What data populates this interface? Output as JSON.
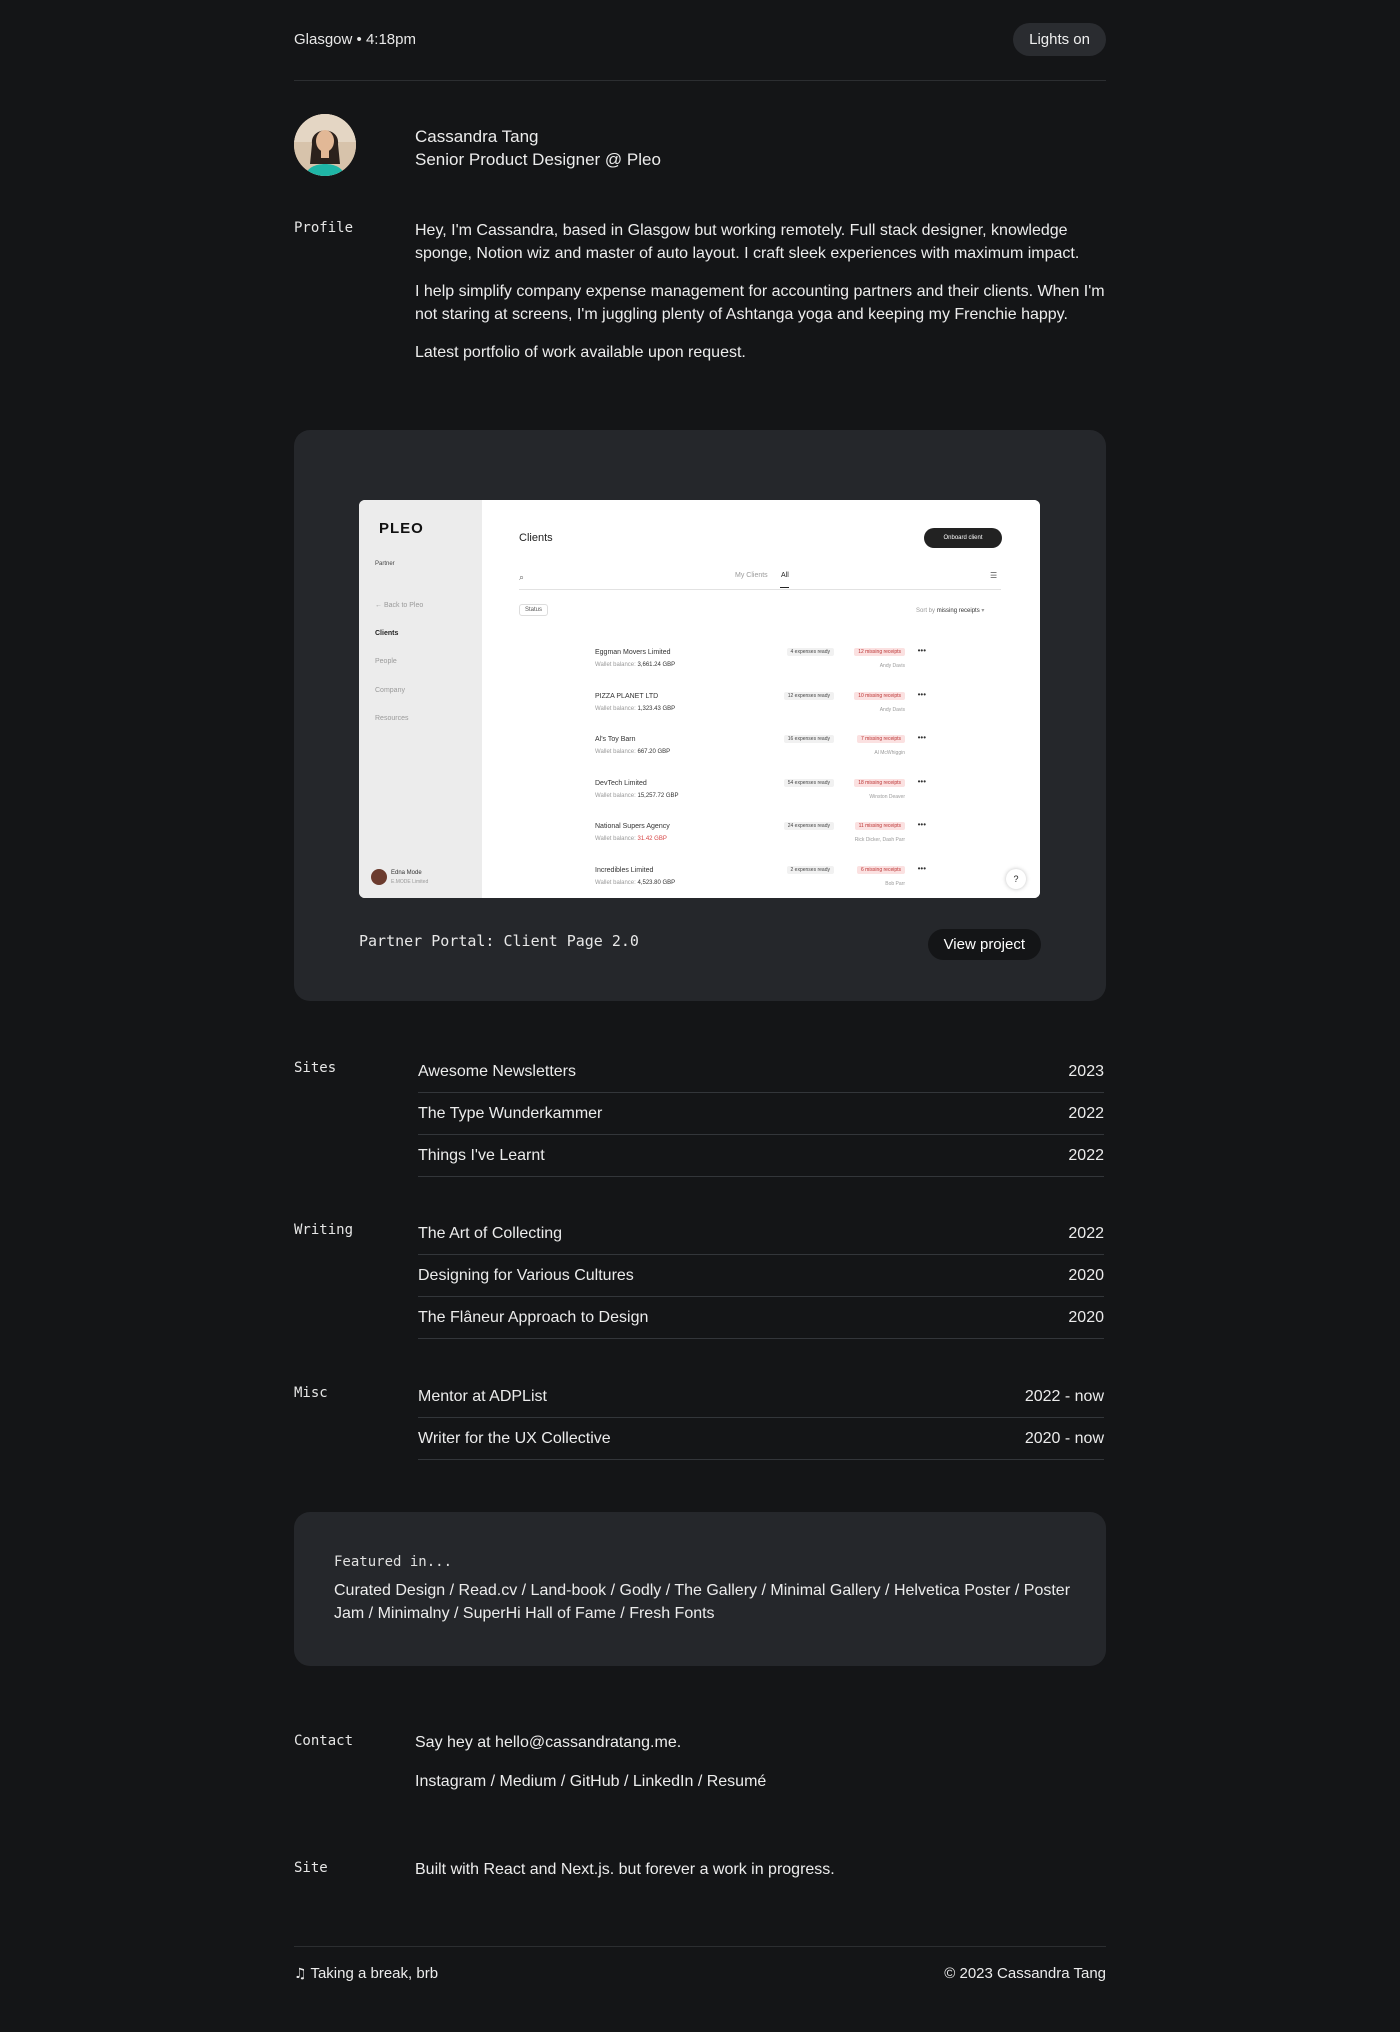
{
  "header": {
    "location_time": "Glasgow • 4:18pm",
    "lights_label": "Lights on"
  },
  "identity": {
    "name": "Cassandra Tang",
    "role": "Senior Product Designer @ Pleo"
  },
  "profile": {
    "label": "Profile",
    "paragraphs": [
      "Hey, I'm Cassandra, based in Glasgow but working remotely. Full stack designer, knowledge sponge, Notion wiz and master of auto layout. I craft sleek experiences with maximum impact.",
      "I help simplify company expense management for accounting partners and their clients. When I'm not staring at screens, I'm juggling plenty of Ashtanga yoga and keeping my Frenchie happy.",
      "Latest portfolio of work available upon request."
    ]
  },
  "project": {
    "caption": "Partner Portal: Client Page 2.0",
    "view_label": "View project",
    "screenshot": {
      "logo": "PLEO",
      "logo_sub": "Partner",
      "back": "← Back to Pleo",
      "nav": [
        "Clients",
        "People",
        "Company",
        "Resources"
      ],
      "user_name": "Edna Mode",
      "user_company": "E.MODE Limited",
      "page_title": "Clients",
      "onboard_label": "Onboard client",
      "tabs": [
        "My Clients",
        "All"
      ],
      "status_filter": "Status",
      "sort_prefix": "Sort by",
      "sort_value": "missing receipts",
      "help": "?",
      "clients": [
        {
          "name": "Eggman Movers Limited",
          "balance_label": "Wallet balance:",
          "balance": "3,661.24 GBP",
          "ready": "4 expenses ready",
          "missing": "12 missing receipts",
          "owner": "Andy Davis"
        },
        {
          "name": "PIZZA PLANET LTD",
          "balance_label": "Wallet balance:",
          "balance": "1,323.43 GBP",
          "ready": "12 expenses ready",
          "missing": "10 missing receipts",
          "owner": "Andy Davis"
        },
        {
          "name": "Al's Toy Barn",
          "balance_label": "Wallet balance:",
          "balance": "667.20 GBP",
          "ready": "16 expenses ready",
          "missing": "7 missing receipts",
          "owner": "Al McWhiggin"
        },
        {
          "name": "DevTech Limited",
          "balance_label": "Wallet balance:",
          "balance": "15,257.72 GBP",
          "ready": "54 expenses ready",
          "missing": "18 missing receipts",
          "owner": "Winston Deaver"
        },
        {
          "name": "National Supers Agency",
          "balance_label": "Wallet balance:",
          "balance": "31.42 GBP",
          "ready": "24 expenses ready",
          "missing": "11 missing receipts",
          "owner": "Rick Dicker, Dash Parr"
        },
        {
          "name": "Incredibles Limited",
          "balance_label": "Wallet balance:",
          "balance": "4,523.80 GBP",
          "ready": "2 expenses ready",
          "missing": "6 missing receipts",
          "owner": "Bob Parr"
        }
      ]
    }
  },
  "sites": {
    "label": "Sites",
    "items": [
      {
        "title": "Awesome Newsletters",
        "year": "2023"
      },
      {
        "title": "The Type Wunderkammer",
        "year": "2022"
      },
      {
        "title": "Things I've Learnt",
        "year": "2022"
      }
    ]
  },
  "writing": {
    "label": "Writing",
    "items": [
      {
        "title": "The Art of Collecting",
        "year": "2022"
      },
      {
        "title": "Designing for Various Cultures",
        "year": "2020"
      },
      {
        "title": "The Flâneur Approach to Design",
        "year": "2020"
      }
    ]
  },
  "misc": {
    "label": "Misc",
    "items": [
      {
        "title": "Mentor at ADPList",
        "year": "2022 - now"
      },
      {
        "title": "Writer for the UX Collective",
        "year": "2020 - now"
      }
    ]
  },
  "featured": {
    "title": "Featured in...",
    "list": "Curated Design / Read.cv / Land-book / Godly / The Gallery / Minimal Gallery / Helvetica Poster / Poster Jam / Minimalny / SuperHi Hall of Fame / Fresh Fonts"
  },
  "contact": {
    "label": "Contact",
    "prefix": "Say hey at ",
    "email": "hello@cassandratang.me",
    "suffix": ".",
    "links": [
      "Instagram",
      "Medium",
      "GitHub",
      "LinkedIn",
      "Resumé"
    ],
    "sep": " / "
  },
  "site": {
    "label": "Site",
    "text": "Built with React and Next.js. but forever a work in progress."
  },
  "footer": {
    "now_playing": "Taking a break, brb",
    "copyright": "© 2023 Cassandra Tang"
  },
  "colors": {
    "background": "#141517",
    "card": "#25272b",
    "missing_badge": "#fbe1e1",
    "danger": "#d64545"
  }
}
